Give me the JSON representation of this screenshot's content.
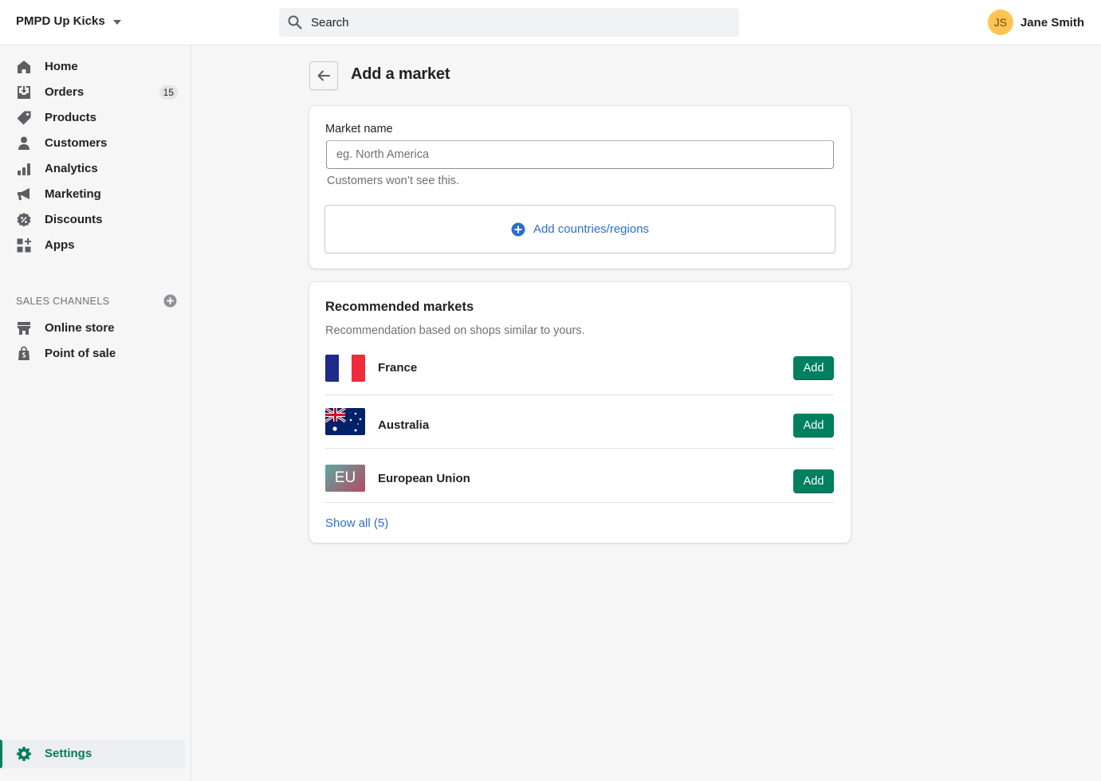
{
  "header": {
    "store_name": "PMPD Up Kicks",
    "search_placeholder": "Search",
    "user_initials": "JS",
    "user_name": "Jane Smith"
  },
  "sidebar": {
    "items": [
      {
        "label": "Home",
        "icon": "home-icon"
      },
      {
        "label": "Orders",
        "icon": "orders-icon",
        "badge": "15"
      },
      {
        "label": "Products",
        "icon": "tag-icon"
      },
      {
        "label": "Customers",
        "icon": "person-icon"
      },
      {
        "label": "Analytics",
        "icon": "bar-chart-icon"
      },
      {
        "label": "Marketing",
        "icon": "megaphone-icon"
      },
      {
        "label": "Discounts",
        "icon": "discount-icon"
      },
      {
        "label": "Apps",
        "icon": "apps-icon"
      }
    ],
    "sales_channels_title": "SALES CHANNELS",
    "channels": [
      {
        "label": "Online store",
        "icon": "store-icon"
      },
      {
        "label": "Point of sale",
        "icon": "shopping-bag-icon"
      }
    ],
    "settings_label": "Settings",
    "accent_color": "#008060"
  },
  "page": {
    "title": "Add a market",
    "market_name_label": "Market name",
    "market_name_placeholder": "eg. North America",
    "market_name_value": "",
    "help_text": "Customers won’t see this.",
    "add_countries_label": "Add countries/regions"
  },
  "recommended": {
    "title": "Recommended markets",
    "subtitle": "Recommendation based on shops similar to yours.",
    "markets": [
      {
        "name": "France",
        "flag": "france-flag",
        "button": "Add"
      },
      {
        "name": "Australia",
        "flag": "australia-flag",
        "button": "Add"
      },
      {
        "name": "European Union",
        "flag_text": "EU",
        "button": "Add"
      }
    ],
    "show_all": "Show all (5)"
  }
}
